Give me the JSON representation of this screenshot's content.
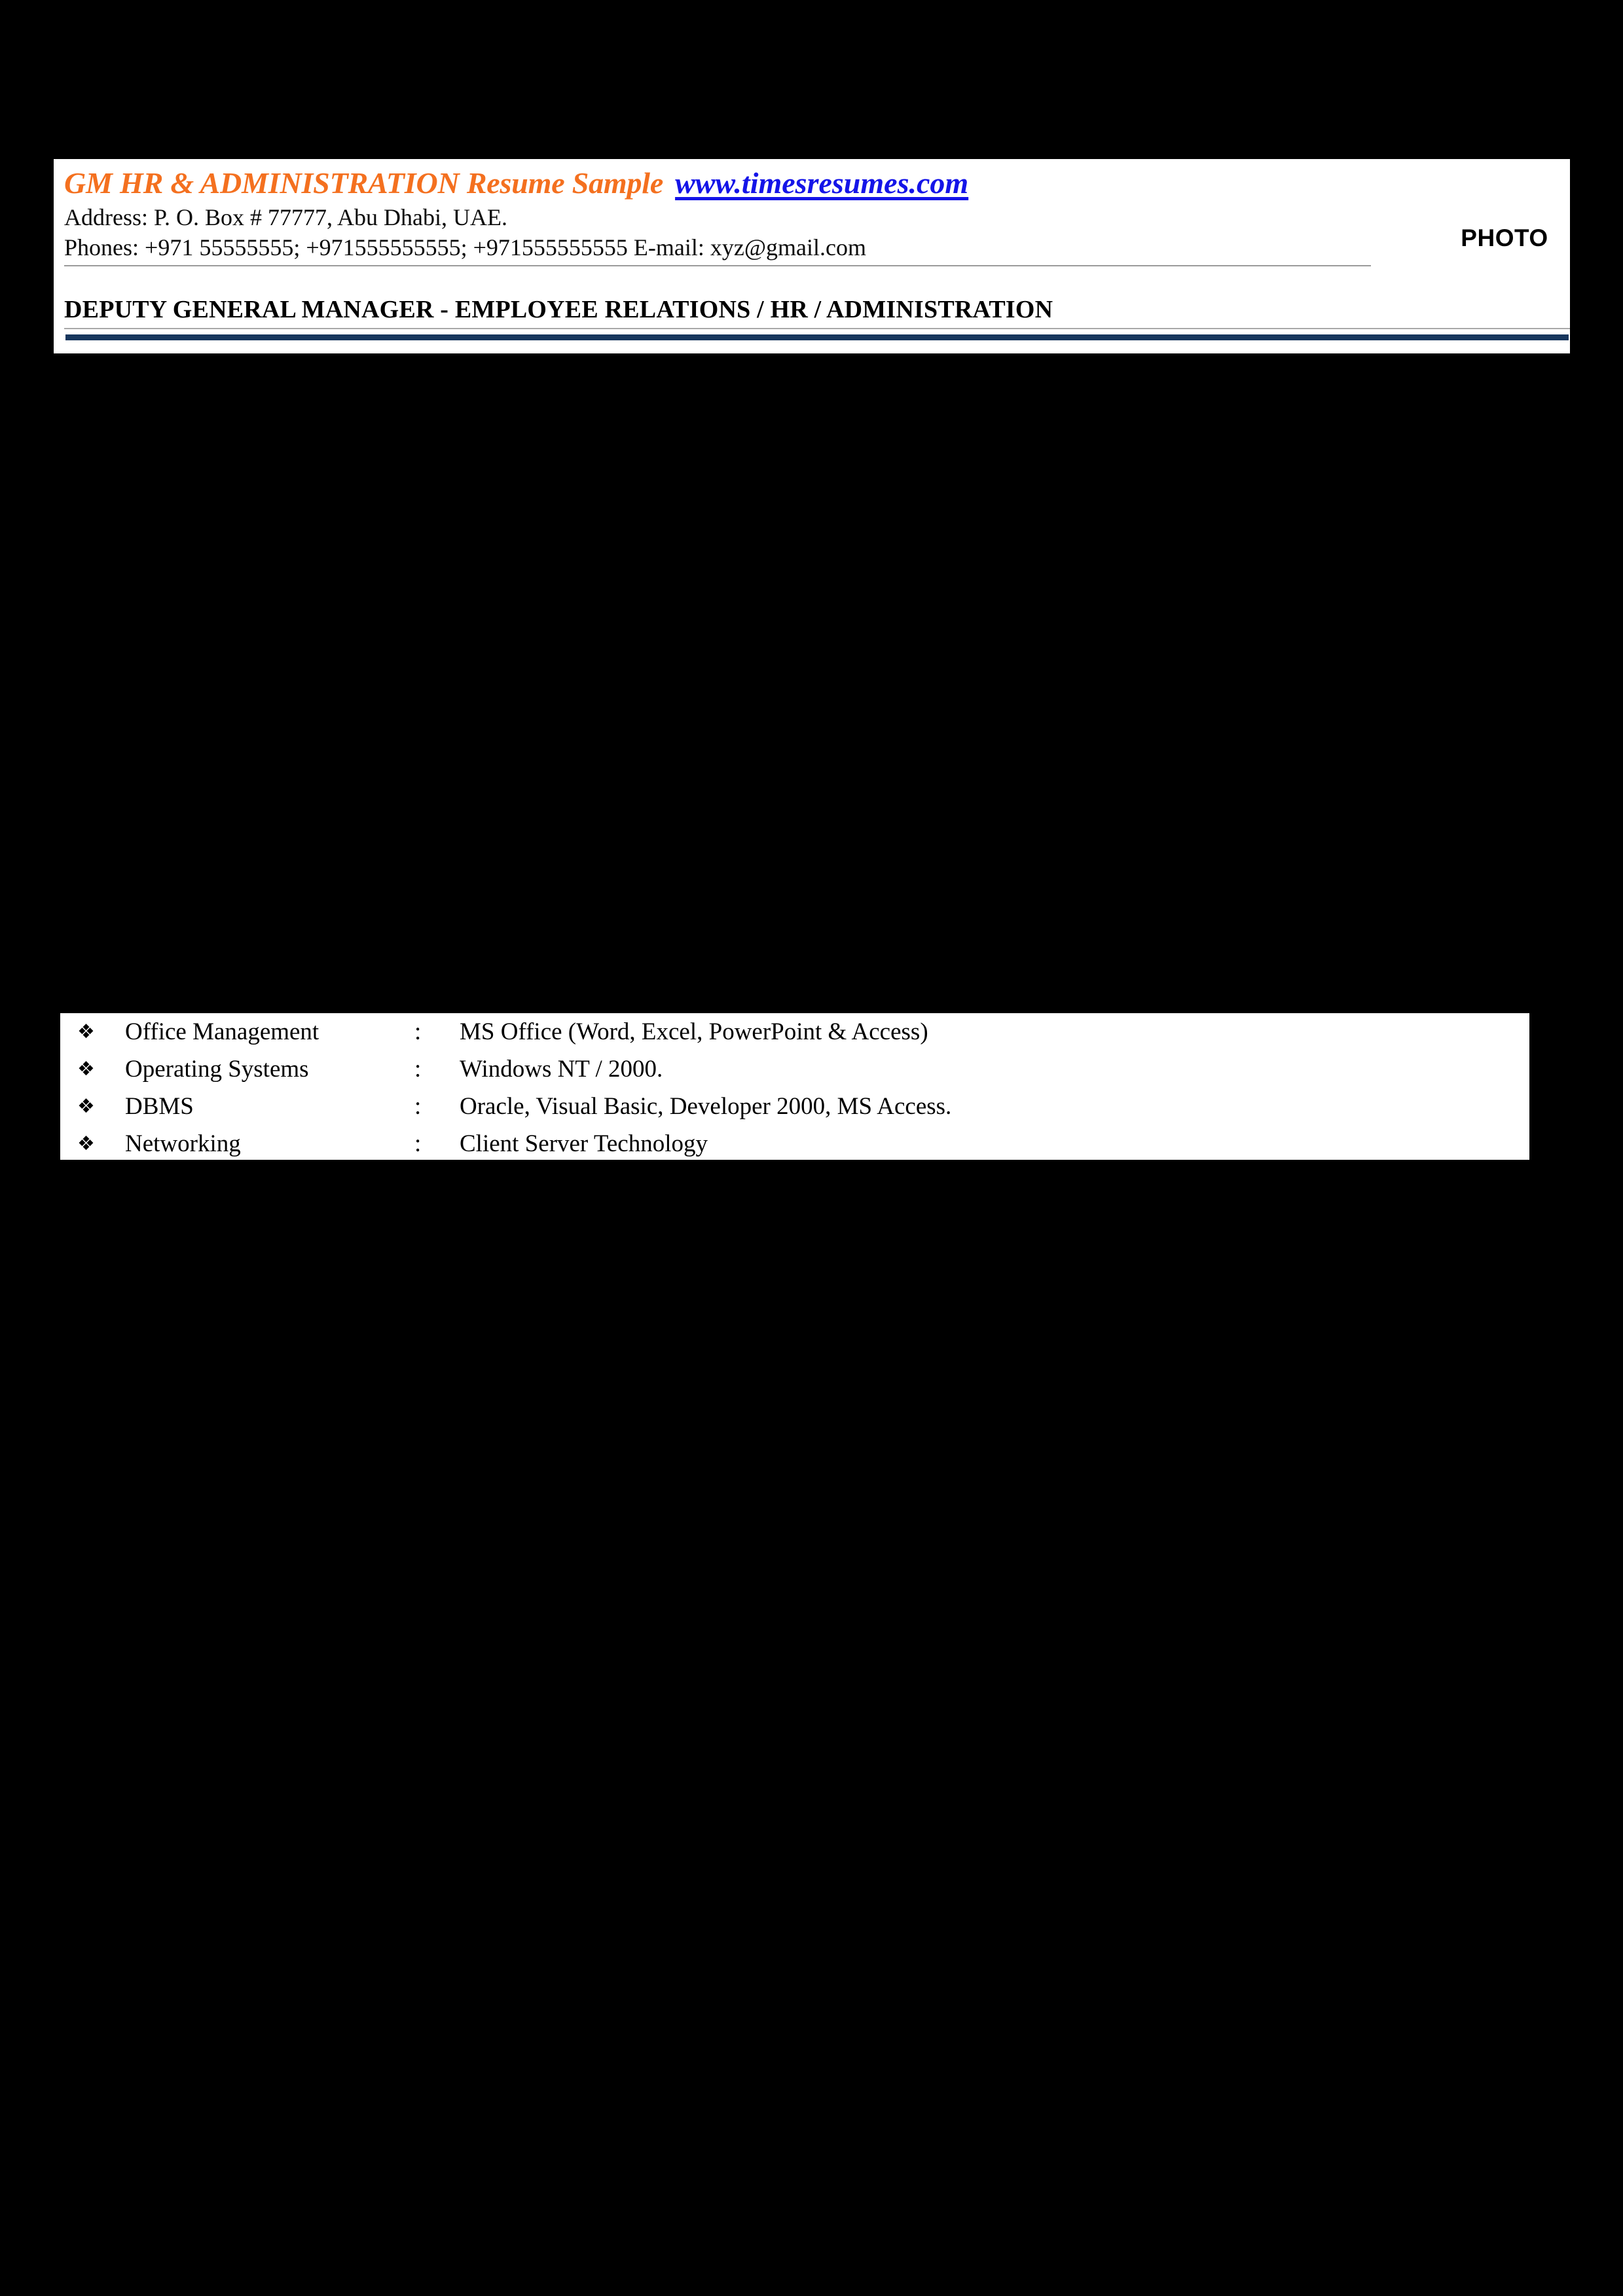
{
  "page": {
    "background_color": "#000000",
    "paper_color": "#ffffff"
  },
  "header": {
    "title": "GM HR & ADMINISTRATION Resume Sample",
    "title_color": "#F4701F",
    "url": "www.timesresumes.com",
    "url_color": "#1414E8",
    "address_line": "Address:  P. O. Box # 77777, Abu Dhabi, UAE.",
    "phones_line": "Phones:  +971 55555555; +971555555555; +971555555555  E-mail: xyz@gmail.com",
    "photo_placeholder": "PHOTO",
    "job_title": "DEPUTY GENERAL MANAGER  -  EMPLOYEE RELATIONS / HR / ADMINISTRATION",
    "accent_rule_color": "#17365D",
    "thin_rule_color": "#9a9a9a"
  },
  "skills": {
    "bullet_glyph": "❖",
    "separator": ":",
    "rows": [
      {
        "label": "Office Management",
        "value": "MS Office (Word, Excel, PowerPoint & Access)"
      },
      {
        "label": "Operating Systems",
        "value": "Windows NT / 2000."
      },
      {
        "label": "DBMS",
        "value": "Oracle, Visual Basic, Developer 2000, MS Access."
      },
      {
        "label": "Networking",
        "value": "Client Server Technology"
      }
    ]
  }
}
